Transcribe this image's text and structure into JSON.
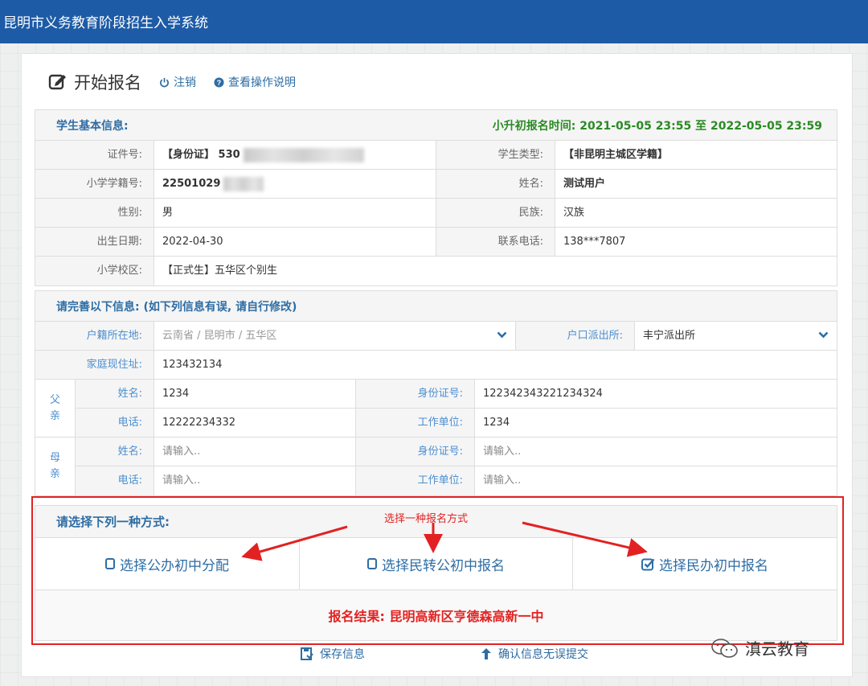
{
  "app": {
    "title": "昆明市义务教育阶段招生入学系统"
  },
  "header": {
    "title": "开始报名",
    "edit_icon": "edit-icon",
    "logout_label": "注销",
    "help_label": "查看操作说明"
  },
  "basic": {
    "heading": "学生基本信息:",
    "time": "小升初报名时间: 2021-05-05 23:55 至 2022-05-05 23:59",
    "id_label": "证件号:",
    "id_value": "【身份证】 530",
    "student_type_label": "学生类型:",
    "student_type_value": "【非昆明主城区学籍】",
    "school_no_label": "小学学籍号:",
    "school_no_value": "22501029",
    "name_label": "姓名:",
    "name_value": "测试用户",
    "gender_label": "性别:",
    "gender_value": "男",
    "ethnic_label": "民族:",
    "ethnic_value": "汉族",
    "birth_label": "出生日期:",
    "birth_value": "2022-04-30",
    "phone_label": "联系电话:",
    "phone_value": "138***7807",
    "school_label": "小学校区:",
    "school_value": "【正式生】五华区个别生"
  },
  "complete": {
    "heading": "请完善以下信息: (如下列信息有误, 请自行修改)",
    "huji_label": "户籍所在地:",
    "huji_province": "云南省",
    "huji_city": "昆明市",
    "huji_district": "五华区",
    "police_label": "户口派出所:",
    "police_value": "丰宁派出所",
    "address_label": "家庭现住址:",
    "address_value": "123432134",
    "father": {
      "label_line1": "父",
      "label_line2": "亲",
      "name_label": "姓名:",
      "name_value": "1234",
      "id_label": "身份证号:",
      "id_value": "122342343221234324",
      "phone_label": "电话:",
      "phone_value": "12222234332",
      "work_label": "工作单位:",
      "work_value": "1234"
    },
    "mother": {
      "label_line1": "母",
      "label_line2": "亲",
      "name_label": "姓名:",
      "name_placeholder": "请输入..",
      "id_label": "身份证号:",
      "id_placeholder": "请输入..",
      "phone_label": "电话:",
      "phone_placeholder": "请输入..",
      "work_label": "工作单位:",
      "work_placeholder": "请输入.."
    }
  },
  "choice": {
    "heading": "请选择下列一种方式:",
    "annotation": "选择一种报名方式",
    "options": [
      {
        "label": "选择公办初中分配",
        "checked": false
      },
      {
        "label": "选择民转公初中报名",
        "checked": false
      },
      {
        "label": "选择民办初中报名",
        "checked": true
      }
    ],
    "result": "报名结果: 昆明高新区亨德森高新一中"
  },
  "footer": {
    "save_label": "保存信息",
    "submit_label": "确认信息无误提交"
  },
  "watermark": {
    "text": "滇云教育"
  },
  "colors": {
    "topbar": "#1d5ba6",
    "accent": "#2e6da4",
    "annotation": "#e22222",
    "time": "#2a8a23"
  }
}
